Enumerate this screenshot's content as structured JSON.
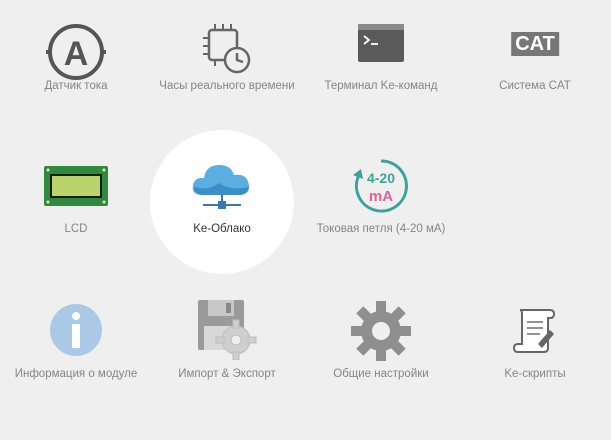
{
  "tiles": {
    "current_sensor": {
      "label": "Датчик тока",
      "icon": "ammeter-icon"
    },
    "rtc": {
      "label": "Часы реального времени",
      "icon": "chip-clock-icon"
    },
    "terminal": {
      "label": "Терминал Ke-команд",
      "icon": "terminal-icon"
    },
    "cat": {
      "label": "Система CAT",
      "icon": "cat-icon",
      "icon_text": "CAT"
    },
    "lcd": {
      "label": "LCD",
      "icon": "lcd-icon"
    },
    "cloud": {
      "label": "Ke-Облако",
      "icon": "cloud-icon",
      "selected": true
    },
    "current_loop": {
      "label": "Токовая петля (4-20 мА)",
      "icon": "current-loop-icon",
      "icon_top": "4-20",
      "icon_bottom": "mA"
    },
    "module_info": {
      "label": "Информация о модуле",
      "icon": "info-icon"
    },
    "import_export": {
      "label": "Импорт & Экспорт",
      "icon": "floppy-gear-icon"
    },
    "general_settings": {
      "label": "Общие настройки",
      "icon": "gear-icon"
    },
    "ke_scripts": {
      "label": "Ke-скрипты",
      "icon": "scroll-icon"
    }
  },
  "colors": {
    "background": "#efefef",
    "cloud": "#5aaee0",
    "loop_teal": "#3aa39a",
    "loop_pink": "#e0609a",
    "info": "#a9c9e6",
    "gear": "#8f8f8f"
  }
}
